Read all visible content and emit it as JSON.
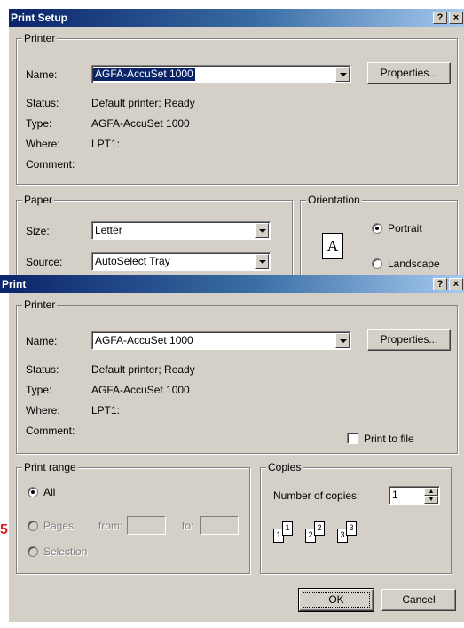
{
  "print_setup": {
    "title": "Print Setup",
    "help_button": "?",
    "close_button": "×",
    "printer_group": {
      "legend": "Printer",
      "name_label": "Name:",
      "name_value": "AGFA-AccuSet 1000",
      "properties_button": "Properties...",
      "status_label": "Status:",
      "status_value": "Default printer; Ready",
      "type_label": "Type:",
      "type_value": "AGFA-AccuSet 1000",
      "where_label": "Where:",
      "where_value": "LPT1:",
      "comment_label": "Comment:"
    },
    "paper_group": {
      "legend": "Paper",
      "size_label": "Size:",
      "size_value": "Letter",
      "source_label": "Source:",
      "source_value": "AutoSelect Tray"
    },
    "orientation_group": {
      "legend": "Orientation",
      "icon_letter": "A",
      "portrait": "Portrait",
      "landscape": "Landscape",
      "selected": "Portrait"
    }
  },
  "print": {
    "title": "Print",
    "help_button": "?",
    "close_button": "×",
    "printer_group": {
      "legend": "Printer",
      "name_label": "Name:",
      "name_value": "AGFA-AccuSet 1000",
      "properties_button": "Properties...",
      "status_label": "Status:",
      "status_value": "Default printer; Ready",
      "type_label": "Type:",
      "type_value": "AGFA-AccuSet 1000",
      "where_label": "Where:",
      "where_value": "LPT1:",
      "comment_label": "Comment:",
      "print_to_file": "Print to file"
    },
    "print_range": {
      "legend": "Print range",
      "all": "All",
      "pages": "Pages",
      "from_label": "from:",
      "to_label": "to:",
      "selection": "Selection",
      "selected": "All"
    },
    "copies": {
      "legend": "Copies",
      "number_label": "Number of copies:",
      "number_value": "1",
      "collate_pages": [
        "1",
        "1",
        "2",
        "2",
        "3",
        "3"
      ]
    },
    "ok_button": "OK",
    "cancel_button": "Cancel"
  },
  "annotation": {
    "text": "5",
    "color": "#e02020"
  }
}
